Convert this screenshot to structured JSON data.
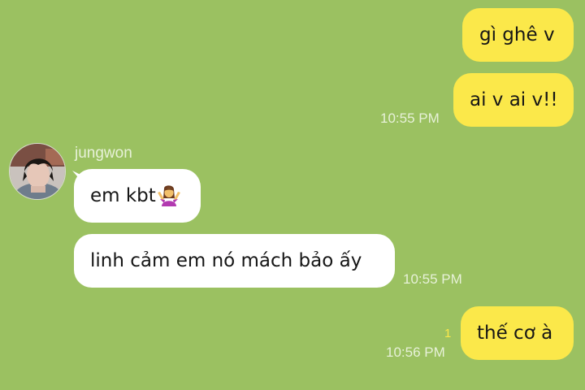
{
  "conversation": {
    "contact_name": "jungwon",
    "messages": [
      {
        "direction": "out",
        "text": "gì ghê v",
        "time": ""
      },
      {
        "direction": "out",
        "text": "ai v ai v!!",
        "time": "10:55 PM"
      },
      {
        "direction": "in",
        "text": "em kbt",
        "emoji": "woman-shrugging-icon",
        "time": ""
      },
      {
        "direction": "in",
        "text": "linh cảm em nó mách bảo ấy",
        "time": "10:55 PM"
      },
      {
        "direction": "out",
        "text": "thế cơ à",
        "time": "10:56 PM",
        "unread_count": "1"
      }
    ]
  },
  "colors": {
    "background": "#9bc161",
    "outgoing_bubble": "#fbe84a",
    "incoming_bubble": "#ffffff",
    "timestamp": "#e7f1d8",
    "unread_badge": "#fbe84a"
  }
}
